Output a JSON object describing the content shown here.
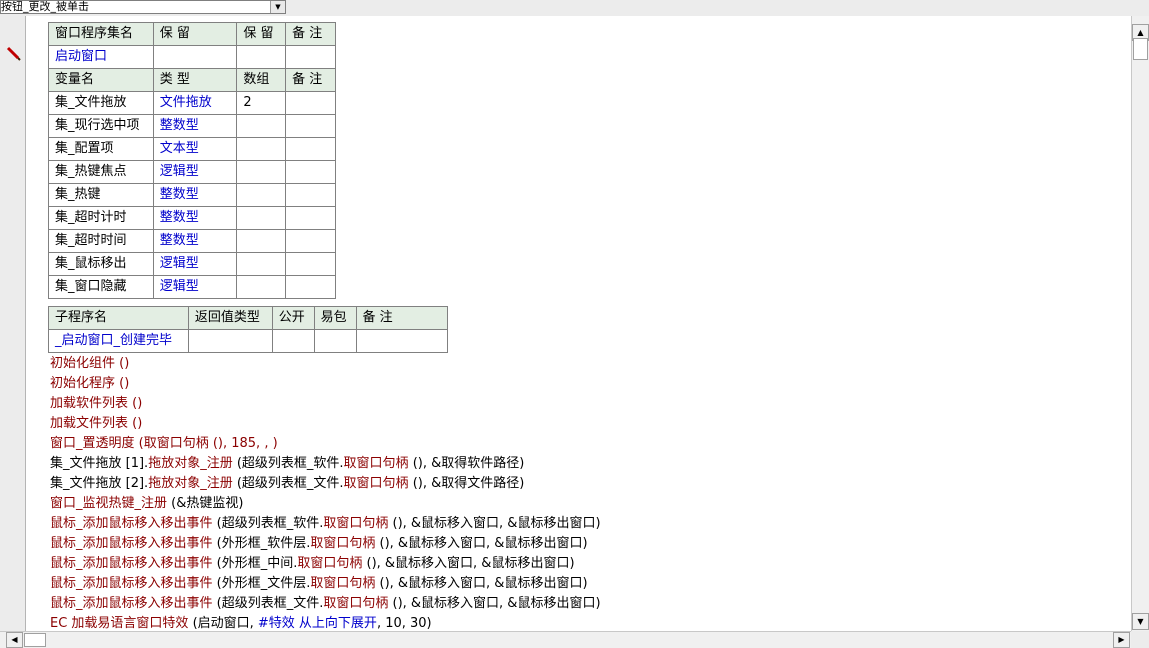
{
  "event_selector": {
    "value": "按钮_更改_被单击"
  },
  "window_table": {
    "header": [
      "窗口程序集名",
      "保 留",
      "保 留",
      "备 注"
    ],
    "name": "启动窗口",
    "var_header": [
      "变量名",
      "类 型",
      "数组",
      "备 注"
    ],
    "variables": [
      {
        "name": "集_文件拖放",
        "type": "文件拖放",
        "array": "2"
      },
      {
        "name": "集_现行选中项",
        "type": "整数型",
        "array": ""
      },
      {
        "name": "集_配置项",
        "type": "文本型",
        "array": ""
      },
      {
        "name": "集_热键焦点",
        "type": "逻辑型",
        "array": ""
      },
      {
        "name": "集_热键",
        "type": "整数型",
        "array": ""
      },
      {
        "name": "集_超时计时",
        "type": "整数型",
        "array": ""
      },
      {
        "name": "集_超时时间",
        "type": "整数型",
        "array": ""
      },
      {
        "name": "集_鼠标移出",
        "type": "逻辑型",
        "array": ""
      },
      {
        "name": "集_窗口隐藏",
        "type": "逻辑型",
        "array": ""
      }
    ]
  },
  "sub_table": {
    "header": [
      "子程序名",
      "返回值类型",
      "公开",
      "易包",
      "备 注"
    ],
    "name": "_启动窗口_创建完毕"
  },
  "code_lines": [
    {
      "parts": [
        {
          "t": "初始化组件 ()",
          "c": "r"
        }
      ]
    },
    {
      "parts": [
        {
          "t": "初始化程序 ()",
          "c": "r"
        }
      ]
    },
    {
      "parts": [
        {
          "t": "加载软件列表 ()",
          "c": "r"
        }
      ]
    },
    {
      "parts": [
        {
          "t": "加载文件列表 ()",
          "c": "r"
        }
      ]
    },
    {
      "parts": [
        {
          "t": "窗口_置透明度 (取窗口句柄 (), 185, , )",
          "c": "r"
        }
      ]
    },
    {
      "parts": [
        {
          "t": "集_文件拖放 [1].",
          "c": "b"
        },
        {
          "t": "拖放对象_注册 ",
          "c": "r"
        },
        {
          "t": "(超级列表框_软件.",
          "c": "b"
        },
        {
          "t": "取窗口句柄 ",
          "c": "r"
        },
        {
          "t": "(), &取得软件路径)",
          "c": "b"
        }
      ]
    },
    {
      "parts": [
        {
          "t": "集_文件拖放 [2].",
          "c": "b"
        },
        {
          "t": "拖放对象_注册 ",
          "c": "r"
        },
        {
          "t": "(超级列表框_文件.",
          "c": "b"
        },
        {
          "t": "取窗口句柄 ",
          "c": "r"
        },
        {
          "t": "(), &取得文件路径)",
          "c": "b"
        }
      ]
    },
    {
      "parts": [
        {
          "t": "窗口_监视热键_注册 ",
          "c": "r"
        },
        {
          "t": "(&热键监视)",
          "c": "b"
        }
      ]
    },
    {
      "parts": [
        {
          "t": "鼠标_添加鼠标移入移出事件 ",
          "c": "r"
        },
        {
          "t": "(超级列表框_软件.",
          "c": "b"
        },
        {
          "t": "取窗口句柄 ",
          "c": "r"
        },
        {
          "t": "(), &鼠标移入窗口, &鼠标移出窗口)",
          "c": "b"
        }
      ]
    },
    {
      "parts": [
        {
          "t": "鼠标_添加鼠标移入移出事件 ",
          "c": "r"
        },
        {
          "t": "(外形框_软件层.",
          "c": "b"
        },
        {
          "t": "取窗口句柄 ",
          "c": "r"
        },
        {
          "t": "(), &鼠标移入窗口, &鼠标移出窗口)",
          "c": "b"
        }
      ]
    },
    {
      "parts": [
        {
          "t": "鼠标_添加鼠标移入移出事件 ",
          "c": "r"
        },
        {
          "t": "(外形框_中间.",
          "c": "b"
        },
        {
          "t": "取窗口句柄 ",
          "c": "r"
        },
        {
          "t": "(), &鼠标移入窗口, &鼠标移出窗口)",
          "c": "b"
        }
      ]
    },
    {
      "parts": [
        {
          "t": "鼠标_添加鼠标移入移出事件 ",
          "c": "r"
        },
        {
          "t": "(外形框_文件层.",
          "c": "b"
        },
        {
          "t": "取窗口句柄 ",
          "c": "r"
        },
        {
          "t": "(), &鼠标移入窗口, &鼠标移出窗口)",
          "c": "b"
        }
      ]
    },
    {
      "parts": [
        {
          "t": "鼠标_添加鼠标移入移出事件 ",
          "c": "r"
        },
        {
          "t": "(超级列表框_文件.",
          "c": "b"
        },
        {
          "t": "取窗口句柄 ",
          "c": "r"
        },
        {
          "t": "(), &鼠标移入窗口, &鼠标移出窗口)",
          "c": "b"
        }
      ]
    },
    {
      "parts": [
        {
          "t": "EC 加载易语言窗口特效 ",
          "c": "r"
        },
        {
          "t": "(启动窗口, ",
          "c": "b"
        },
        {
          "t": "#特效 从上向下展开",
          "c": "bl"
        },
        {
          "t": ", 10, 30)",
          "c": "b"
        }
      ]
    }
  ],
  "colors": {
    "keyword": "#8b0000",
    "type": "#0000cc",
    "header_bg": "#e3eee3"
  },
  "icons": {
    "edit": "pencil-icon",
    "up": "arrow-up-icon",
    "down": "arrow-down-icon",
    "left": "arrow-left-icon",
    "right": "arrow-right-icon",
    "dropdown": "chevron-down-icon"
  }
}
